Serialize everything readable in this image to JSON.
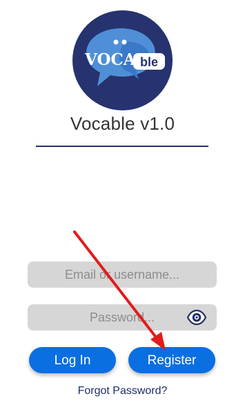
{
  "app": {
    "title": "Vocable v1.0",
    "logo_text_main": "VOCA",
    "logo_text_badge": "ble",
    "logo_icon": "chat-bubble-logo"
  },
  "form": {
    "email_placeholder": "Email or username...",
    "email_value": "",
    "password_placeholder": "Password...",
    "password_value": "",
    "password_toggle_icon": "eye-icon"
  },
  "actions": {
    "login_label": "Log In",
    "register_label": "Register",
    "forgot_label": "Forgot Password?"
  },
  "colors": {
    "primary": "#0a6fe0",
    "navy": "#26336f",
    "field_bg": "#d6d6d6",
    "annotation_arrow": "#e31b1b"
  }
}
